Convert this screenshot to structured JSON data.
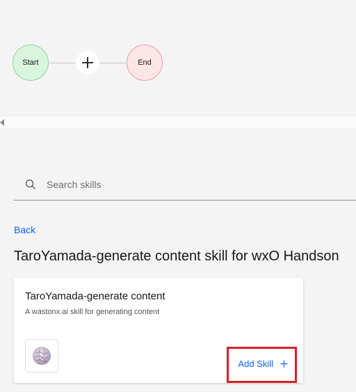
{
  "flow": {
    "start_label": "Start",
    "end_label": "End"
  },
  "search": {
    "placeholder": "Search skills",
    "value": ""
  },
  "nav": {
    "back_label": "Back"
  },
  "page": {
    "title": "TaroYamada-generate content skill for wxO Handson"
  },
  "skill_card": {
    "title": "TaroYamada-generate content",
    "description": "A wastonx.ai skill for generating content",
    "add_label": "Add Skill",
    "add_icon": "plus-icon"
  },
  "colors": {
    "link": "#0f62fe",
    "start_fill": "#d9f5de",
    "end_fill": "#fde6e6",
    "highlight": "#da1e28"
  }
}
